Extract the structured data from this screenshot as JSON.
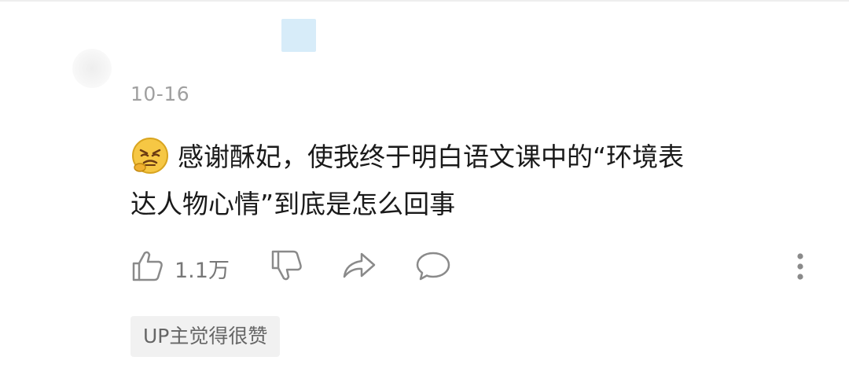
{
  "comment": {
    "date": "10-16",
    "emoji_icon": "angry-emoji-icon",
    "text_line1": "感谢酥妃，使我终于明白语文课中的“环境表",
    "text_line2": "达人物心情”到底是怎么回事"
  },
  "actions": {
    "like_count": "1.1万",
    "icons": [
      "thumbs-up-icon",
      "thumbs-down-icon",
      "share-icon",
      "reply-icon",
      "more-icon"
    ]
  },
  "tag": {
    "label": "UP主觉得很赞"
  },
  "colors": {
    "avatar_placeholder": "#eeeeee",
    "name_placeholder": "#d7ecf9",
    "text": "#1a1a1a",
    "muted": "#a0a0a0",
    "tag_bg": "#f1f1f1"
  }
}
